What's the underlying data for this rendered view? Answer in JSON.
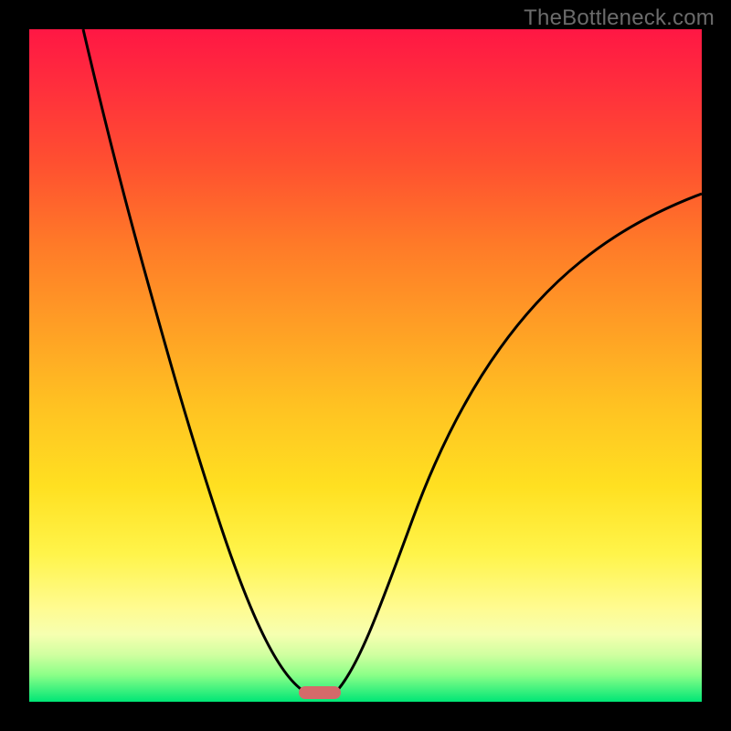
{
  "watermark": "TheBottleneck.com",
  "colors": {
    "frame": "#000000",
    "marker": "#d46a6a",
    "curve": "#000000",
    "gradient_top": "#ff1744",
    "gradient_bottom": "#00e676"
  },
  "chart_data": {
    "type": "line",
    "title": "",
    "xlabel": "",
    "ylabel": "",
    "xlim": [
      0,
      1
    ],
    "ylim": [
      0,
      1
    ],
    "note": "Two monotone curves descending to a common minimum near x≈0.43 (y≈0), forming a V shape; left branch starts at (≈0.08,1), right branch ends at (1,≈0.75). Background is a vertical red→green gradient. A small rounded marker sits at the valley bottom.",
    "marker": {
      "x_fraction": 0.43,
      "y_fraction": 0.985
    },
    "series": [
      {
        "name": "left-branch",
        "x": [
          0.08,
          0.12,
          0.16,
          0.2,
          0.24,
          0.28,
          0.32,
          0.36,
          0.4,
          0.415
        ],
        "y": [
          1.0,
          0.84,
          0.69,
          0.55,
          0.42,
          0.3,
          0.19,
          0.095,
          0.025,
          0.0
        ]
      },
      {
        "name": "right-branch",
        "x": [
          0.45,
          0.48,
          0.52,
          0.56,
          0.6,
          0.65,
          0.7,
          0.76,
          0.82,
          0.88,
          0.94,
          1.0
        ],
        "y": [
          0.0,
          0.06,
          0.15,
          0.24,
          0.32,
          0.405,
          0.48,
          0.555,
          0.62,
          0.675,
          0.72,
          0.755
        ]
      }
    ]
  }
}
